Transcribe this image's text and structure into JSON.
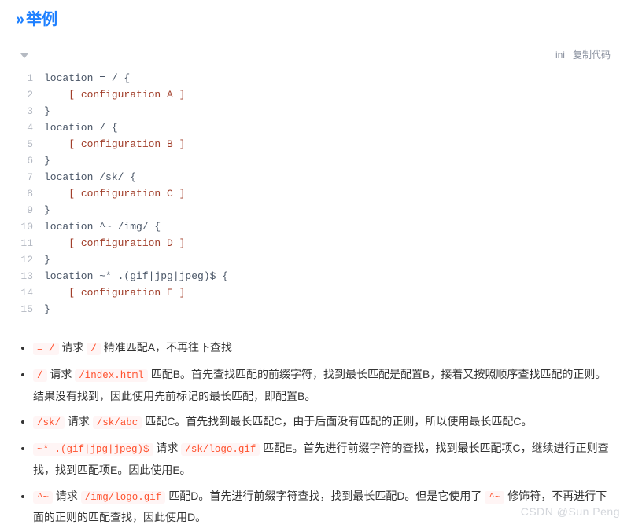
{
  "heading": {
    "arrows": "»",
    "text": "举例"
  },
  "toolbar": {
    "lang": "ini",
    "copy": "复制代码"
  },
  "code": {
    "lines": [
      [
        {
          "t": "location = / {",
          "c": "tok-kw"
        }
      ],
      [
        {
          "t": "    ",
          "c": ""
        },
        {
          "t": "[ configuration A ]",
          "c": "tok-bracket"
        }
      ],
      [
        {
          "t": "}",
          "c": "tok-kw"
        }
      ],
      [
        {
          "t": "location / {",
          "c": "tok-kw"
        }
      ],
      [
        {
          "t": "    ",
          "c": ""
        },
        {
          "t": "[ configuration B ]",
          "c": "tok-bracket"
        }
      ],
      [
        {
          "t": "}",
          "c": "tok-kw"
        }
      ],
      [
        {
          "t": "location /sk/ {",
          "c": "tok-kw"
        }
      ],
      [
        {
          "t": "    ",
          "c": ""
        },
        {
          "t": "[ configuration C ]",
          "c": "tok-bracket"
        }
      ],
      [
        {
          "t": "}",
          "c": "tok-kw"
        }
      ],
      [
        {
          "t": "location ^~ /img/ {",
          "c": "tok-kw"
        }
      ],
      [
        {
          "t": "    ",
          "c": ""
        },
        {
          "t": "[ configuration D ]",
          "c": "tok-bracket"
        }
      ],
      [
        {
          "t": "}",
          "c": "tok-kw"
        }
      ],
      [
        {
          "t": "location ~* .(gif|jpg|jpeg)$ {",
          "c": "tok-kw"
        }
      ],
      [
        {
          "t": "    ",
          "c": ""
        },
        {
          "t": "[ configuration E ]",
          "c": "tok-bracket"
        }
      ],
      [
        {
          "t": "}",
          "c": "tok-kw"
        }
      ]
    ]
  },
  "bullets": [
    [
      {
        "code": "= /"
      },
      {
        "text": " 请求 "
      },
      {
        "code": "/"
      },
      {
        "text": " 精准匹配A，不再往下查找"
      }
    ],
    [
      {
        "code": "/"
      },
      {
        "text": " 请求 "
      },
      {
        "code": "/index.html"
      },
      {
        "text": " 匹配B。首先查找匹配的前缀字符，找到最长匹配是配置B，接着又按照顺序查找匹配的正则。结果没有找到，因此使用先前标记的最长匹配，即配置B。"
      }
    ],
    [
      {
        "code": "/sk/"
      },
      {
        "text": " 请求 "
      },
      {
        "code": "/sk/abc"
      },
      {
        "text": " 匹配C。首先找到最长匹配C，由于后面没有匹配的正则，所以使用最长匹配C。"
      }
    ],
    [
      {
        "code": "~* .(gif|jpg|jpeg)$"
      },
      {
        "text": " 请求 "
      },
      {
        "code": "/sk/logo.gif"
      },
      {
        "text": " 匹配E。首先进行前缀字符的查找，找到最长匹配项C，继续进行正则查找，找到匹配项E。因此使用E。"
      }
    ],
    [
      {
        "code": "^~"
      },
      {
        "text": " 请求 "
      },
      {
        "code": "/img/logo.gif"
      },
      {
        "text": " 匹配D。首先进行前缀字符查找，找到最长匹配D。但是它使用了 "
      },
      {
        "code": "^~"
      },
      {
        "text": " 修饰符，不再进行下面的正则的匹配查找，因此使用D。"
      }
    ]
  ],
  "watermark": "CSDN @Sun  Peng"
}
